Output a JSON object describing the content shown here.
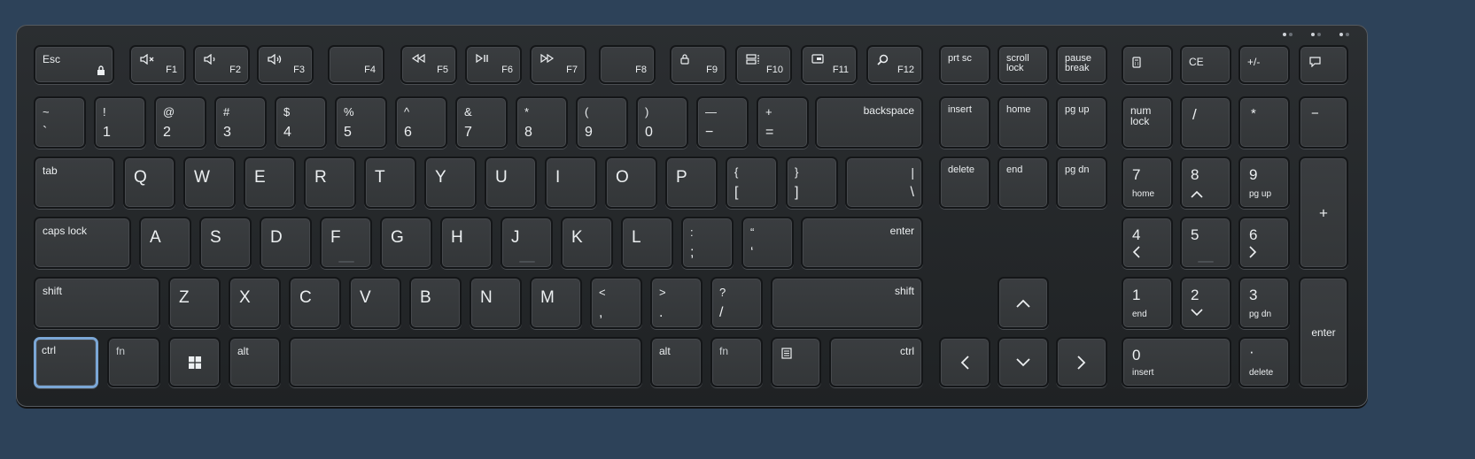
{
  "fn_row": {
    "esc": "Esc",
    "f1": "F1",
    "f2": "F2",
    "f3": "F3",
    "f4": "F4",
    "f5": "F5",
    "f6": "F6",
    "f7": "F7",
    "f8": "F8",
    "f9": "F9",
    "f10": "F10",
    "f11": "F11",
    "f12": "F12",
    "prtsc": "prt sc",
    "scroll_lock": "scroll\nlock",
    "pause_break": "pause\nbreak",
    "ce": "CE",
    "plusminus": "+/-",
    "icons": {
      "esc": "lock-icon",
      "f1": "mute-icon",
      "f2": "volume-down-icon",
      "f3": "volume-up-icon",
      "f5": "previous-track-icon",
      "f6": "play-pause-icon",
      "f7": "next-track-icon",
      "f9": "lock-icon",
      "f10": "display-switch-icon",
      "f11": "screen-icon",
      "f12": "search-icon",
      "calc": "calculator-icon",
      "notify": "message-icon"
    }
  },
  "number_row": [
    {
      "up": "~",
      "low": "`"
    },
    {
      "up": "!",
      "low": "1"
    },
    {
      "up": "@",
      "low": "2"
    },
    {
      "up": "#",
      "low": "3"
    },
    {
      "up": "$",
      "low": "4"
    },
    {
      "up": "%",
      "low": "5"
    },
    {
      "up": "^",
      "low": "6"
    },
    {
      "up": "&",
      "low": "7"
    },
    {
      "up": "*",
      "low": "8"
    },
    {
      "up": "(",
      "low": "9"
    },
    {
      "up": ")",
      "low": "0"
    },
    {
      "up": "—",
      "low": "−"
    },
    {
      "up": "+",
      "low": "="
    }
  ],
  "backspace": "backspace",
  "tab": "tab",
  "row_q": [
    "Q",
    "W",
    "E",
    "R",
    "T",
    "Y",
    "U",
    "I",
    "O",
    "P"
  ],
  "brackets": [
    {
      "up": "{",
      "low": "["
    },
    {
      "up": "}",
      "low": "]"
    }
  ],
  "pipe": {
    "up": "|",
    "low": "\\"
  },
  "caps_lock": "caps lock",
  "row_a": [
    "A",
    "S",
    "D",
    "F",
    "G",
    "H",
    "J",
    "K",
    "L"
  ],
  "semi": {
    "up": ":",
    "low": ";"
  },
  "quote": {
    "up": "“",
    "low": "‘"
  },
  "enter": "enter",
  "shift": "shift",
  "row_z": [
    "Z",
    "X",
    "C",
    "V",
    "B",
    "N",
    "M"
  ],
  "comma": {
    "up": "<",
    "low": ","
  },
  "period": {
    "up": ">",
    "low": "."
  },
  "slash": {
    "up": "?",
    "low": "/"
  },
  "ctrl": "ctrl",
  "fn": "fn",
  "alt": "alt",
  "nav": {
    "insert": "insert",
    "home": "home",
    "pg_up": "pg up",
    "delete": "delete",
    "end": "end",
    "pg_dn": "pg dn"
  },
  "numpad": {
    "num_lock": "num\nlock",
    "divide": "/",
    "multiply": "*",
    "minus": "−",
    "plus": "+",
    "k7": "7",
    "k7_sub": "home",
    "k8": "8",
    "k9": "9",
    "k9_sub": "pg up",
    "k4": "4",
    "k5": "5",
    "k6": "6",
    "k1": "1",
    "k1_sub": "end",
    "k2": "2",
    "k3": "3",
    "k3_sub": "pg dn",
    "k0": "0",
    "k0_sub": "insert",
    "dot": "·",
    "dot_sub": "delete",
    "enter": "enter"
  },
  "selected_key": "left-ctrl"
}
